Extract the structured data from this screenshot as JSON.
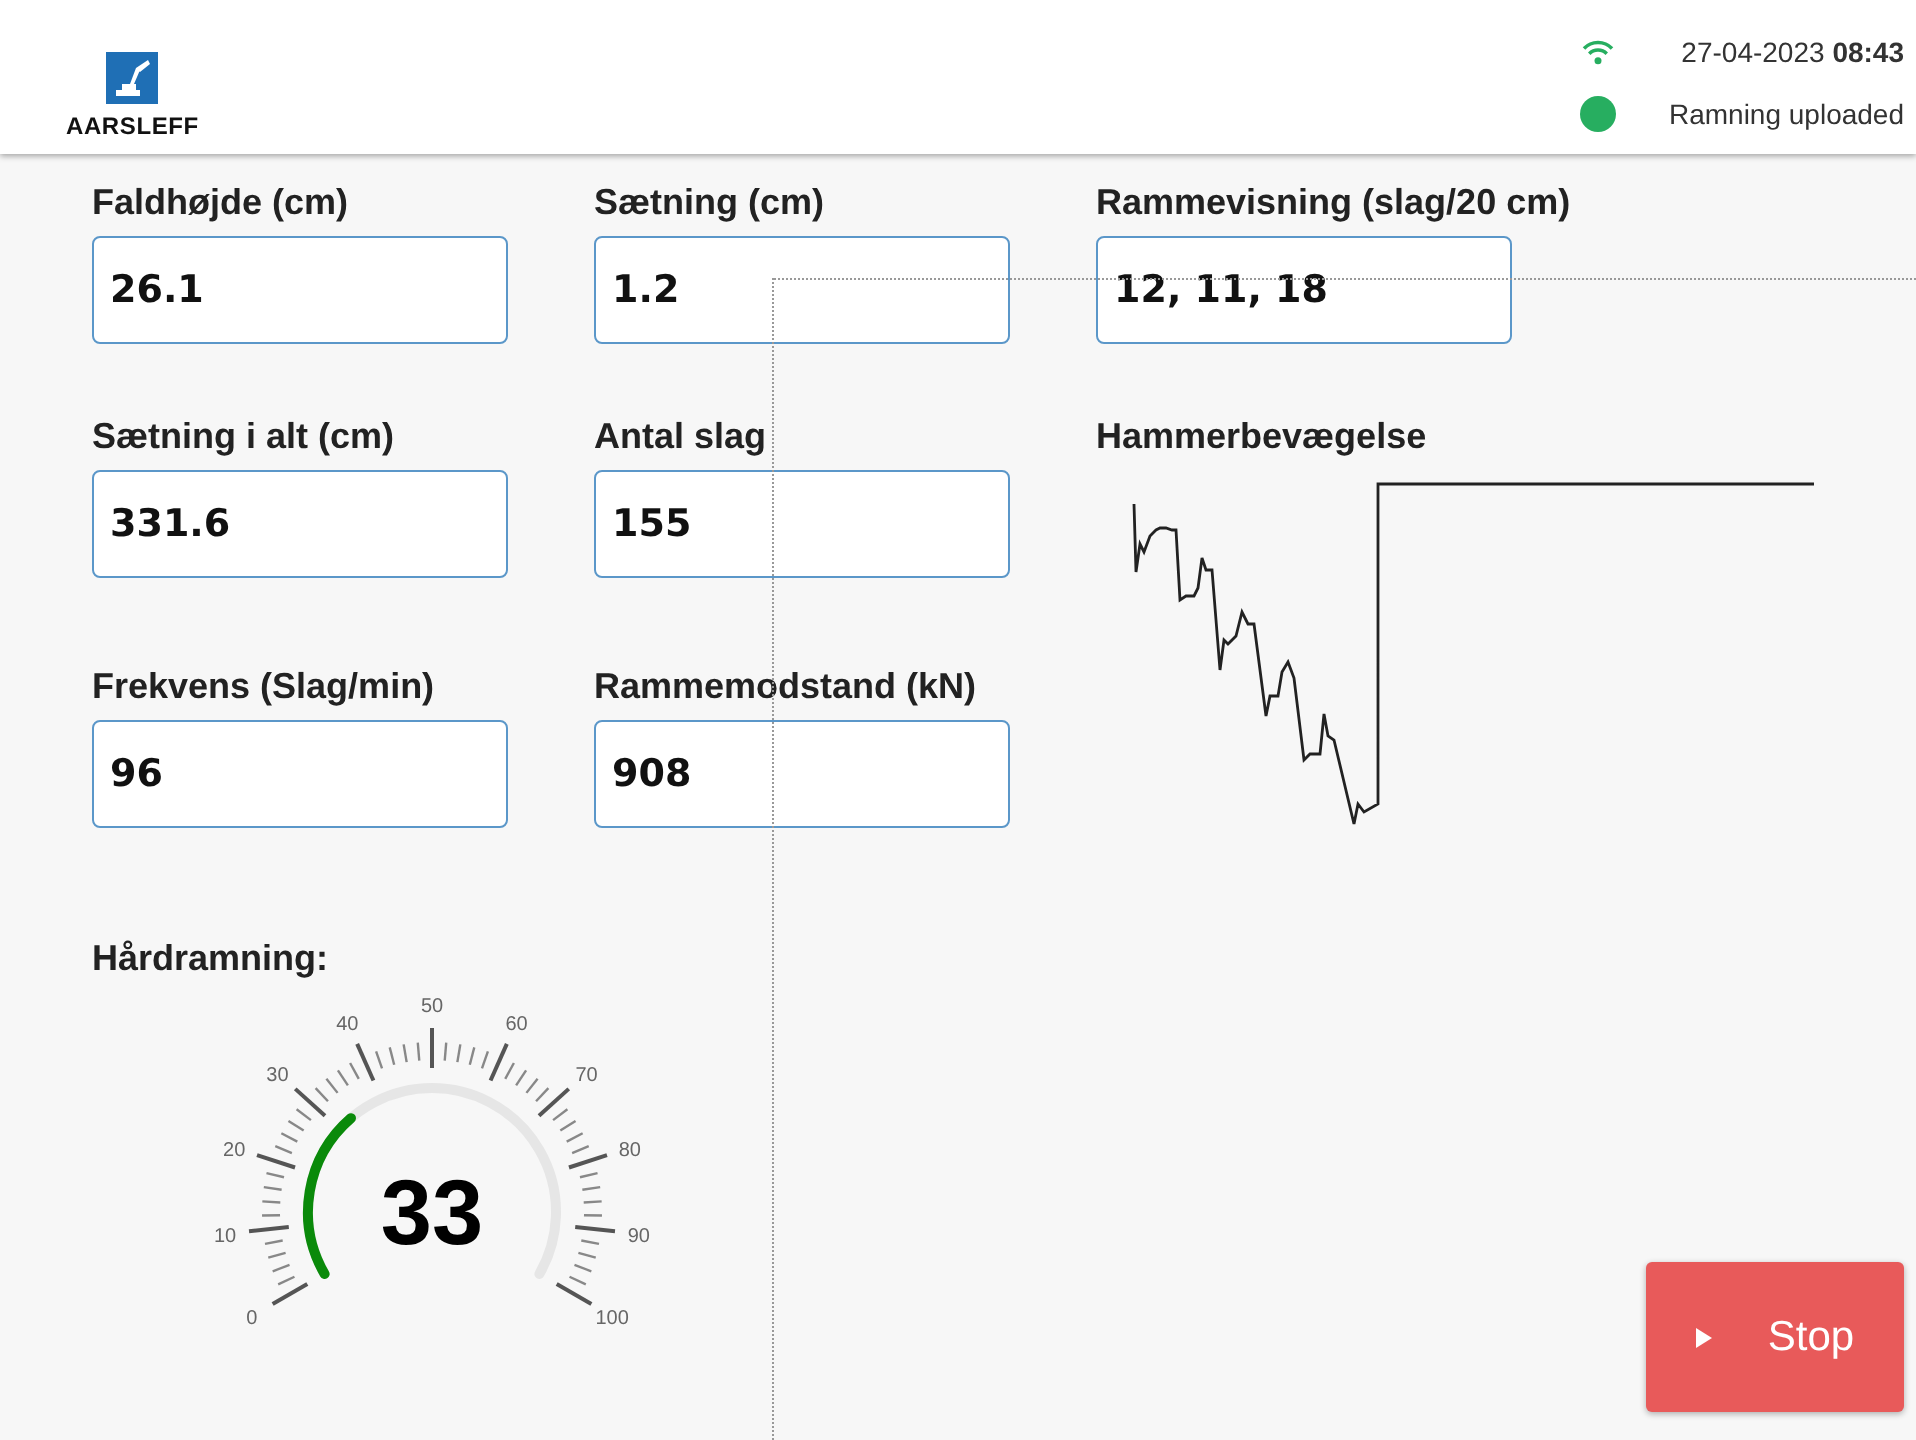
{
  "header": {
    "logo_text": "AARSLEFF",
    "date": "27-04-2023",
    "time": "08:43",
    "status": "Ramning uploaded"
  },
  "fields": [
    {
      "label": "Faldhøjde (cm)",
      "value": "26.1"
    },
    {
      "label": "Sætning (cm)",
      "value": "1.2"
    },
    {
      "label": "Rammevisning (slag/20 cm)",
      "value": "12, 11, 18"
    },
    {
      "label": "Sætning i alt (cm)",
      "value": "331.6"
    },
    {
      "label": "Antal slag",
      "value": "155"
    },
    {
      "label": "Frekvens (Slag/min)",
      "value": "96"
    },
    {
      "label": "Rammemodstand (kN)",
      "value": "908"
    }
  ],
  "chart": {
    "title": "Hammerbevægelse"
  },
  "gauge": {
    "label": "Hårdramning:",
    "value": "33",
    "scale": [
      "0",
      "10",
      "20",
      "30",
      "40",
      "50",
      "60",
      "70",
      "80",
      "90",
      "100"
    ]
  },
  "stop_button": {
    "label": "Stop"
  }
}
